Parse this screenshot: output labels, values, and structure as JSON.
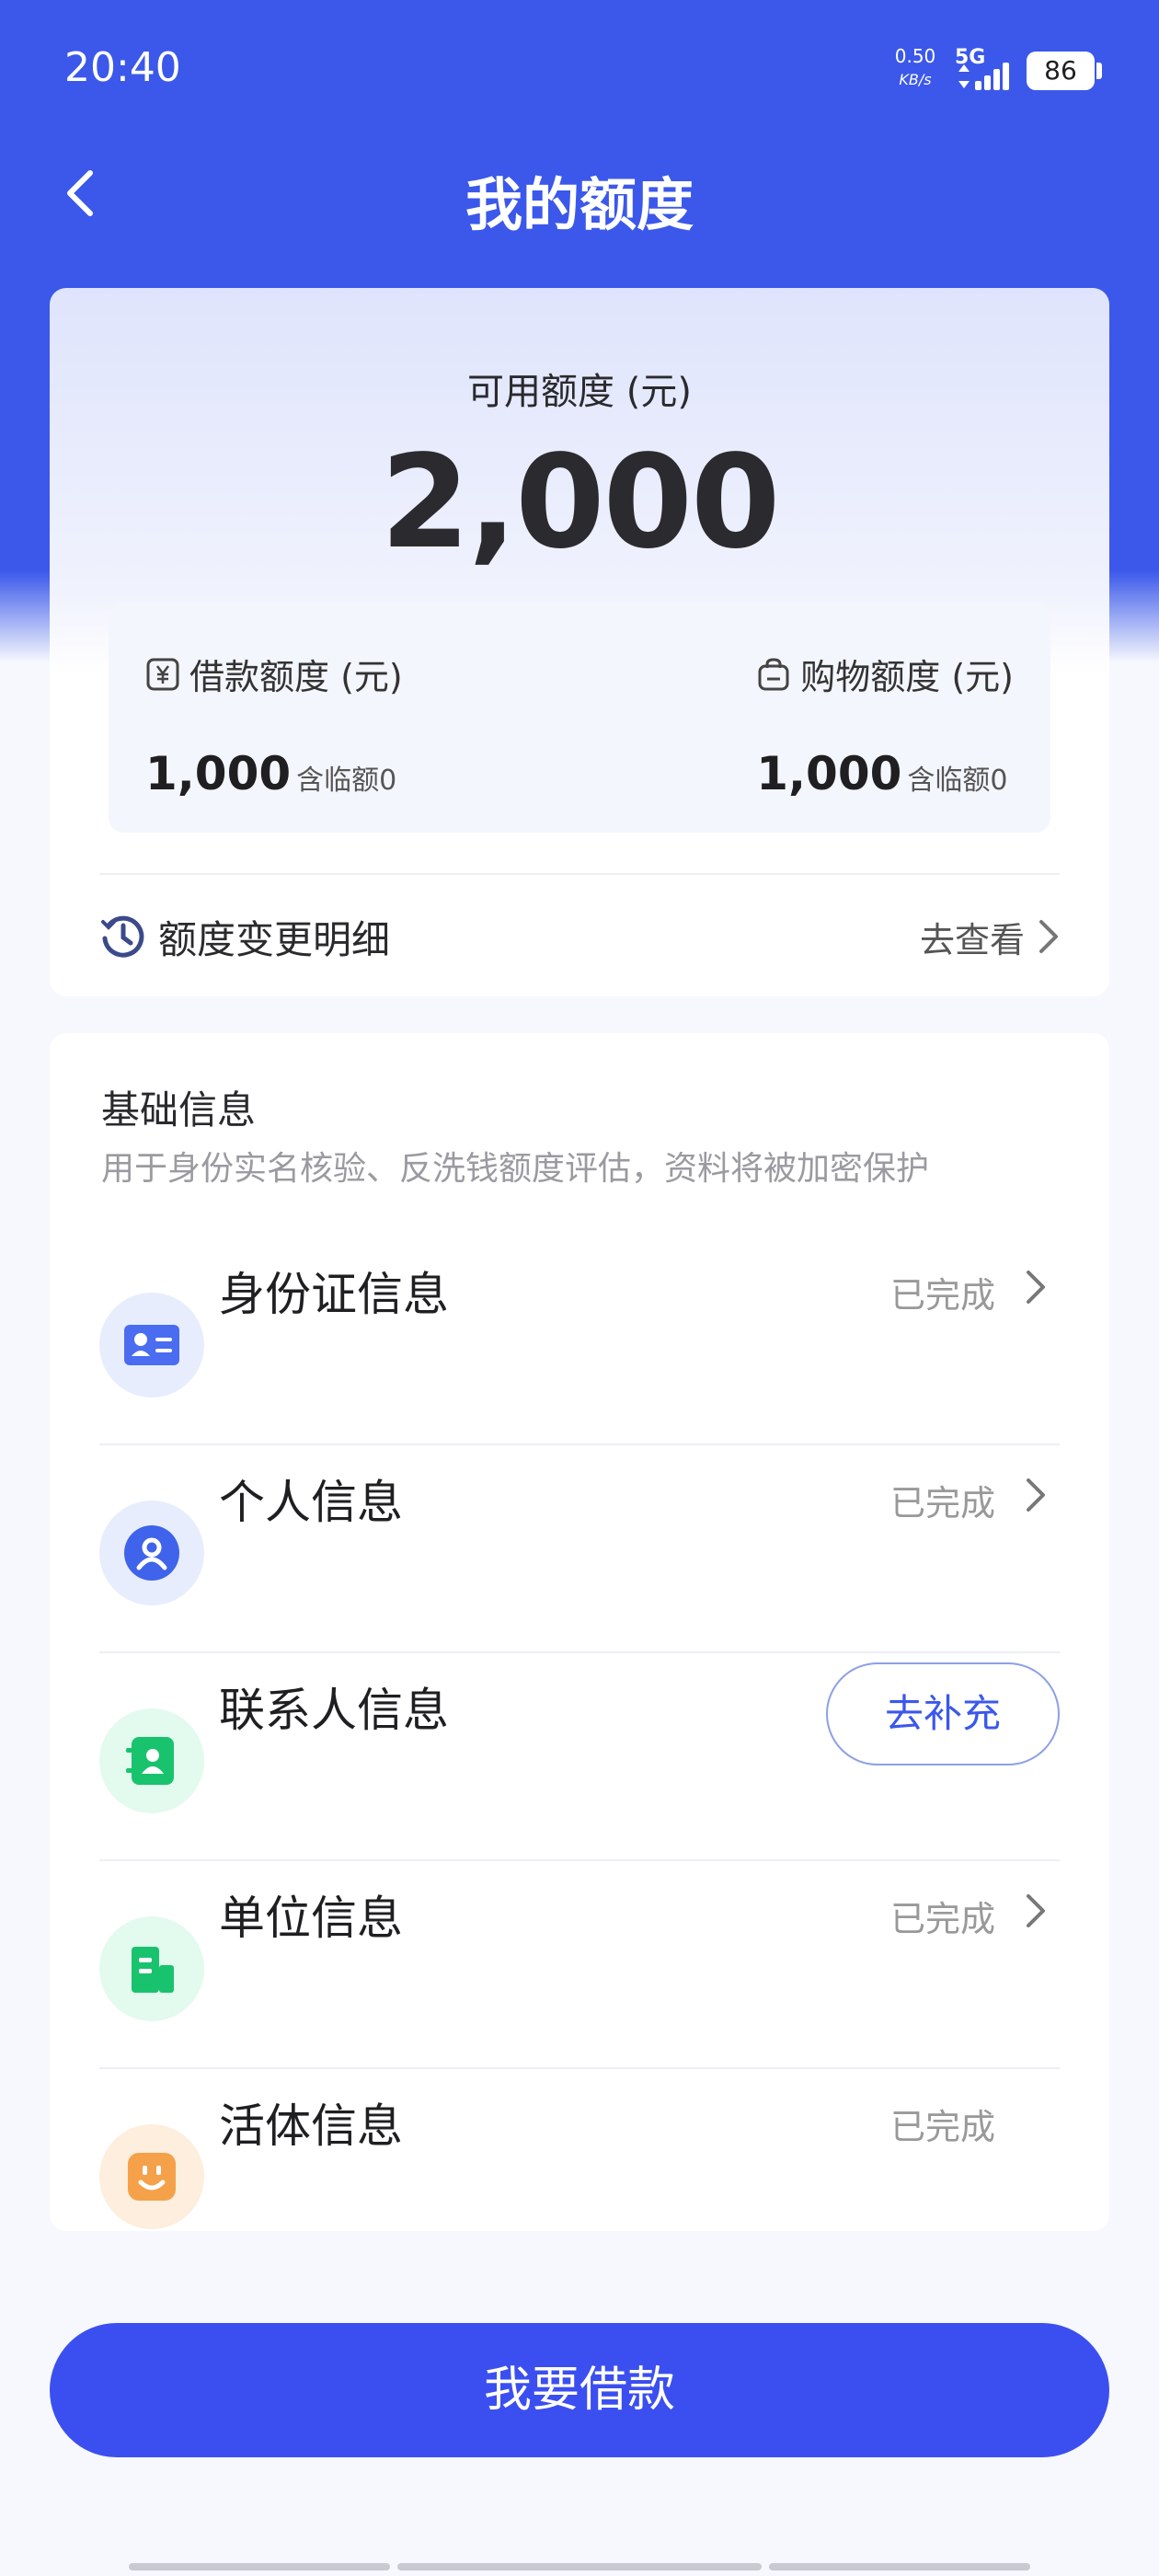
{
  "status_bar": {
    "time": "20:40",
    "speed_value": "0.50",
    "speed_unit": "KB/s",
    "network": "5G",
    "battery": "86"
  },
  "header": {
    "title": "我的额度",
    "back_icon": "chevron-left-icon"
  },
  "quota": {
    "label": "可用额度 (元)",
    "amount": "2,000",
    "loan": {
      "label": "借款额度 (元)",
      "value": "1,000",
      "note": "含临额0",
      "icon": "yuan-note-icon"
    },
    "shopping": {
      "label": "购物额度 (元)",
      "value": "1,000",
      "note": "含临额0",
      "icon": "shopping-bag-icon"
    },
    "history": {
      "label": "额度变更明细",
      "link": "去查看",
      "icon": "history-clock-icon"
    }
  },
  "basic_info": {
    "title": "基础信息",
    "description": "用于身份实名核验、反洗钱额度评估，资料将被加密保护",
    "items": [
      {
        "name": "身份证信息",
        "status": "已完成",
        "icon": "id-card-icon",
        "color": "#4a6cf0"
      },
      {
        "name": "个人信息",
        "status": "已完成",
        "icon": "person-icon",
        "color": "#3f63ea"
      },
      {
        "name": "联系人信息",
        "action": "去补充",
        "icon": "contact-book-icon",
        "color": "#19c36e"
      },
      {
        "name": "单位信息",
        "status": "已完成",
        "icon": "building-icon",
        "color": "#19c36e"
      },
      {
        "name": "活体信息",
        "status": "已完成",
        "icon": "face-icon",
        "color": "#f5a14a"
      }
    ]
  },
  "primary_action": {
    "label": "我要借款"
  },
  "colors": {
    "brand": "#3b58ea",
    "button": "#3b4ff0"
  }
}
